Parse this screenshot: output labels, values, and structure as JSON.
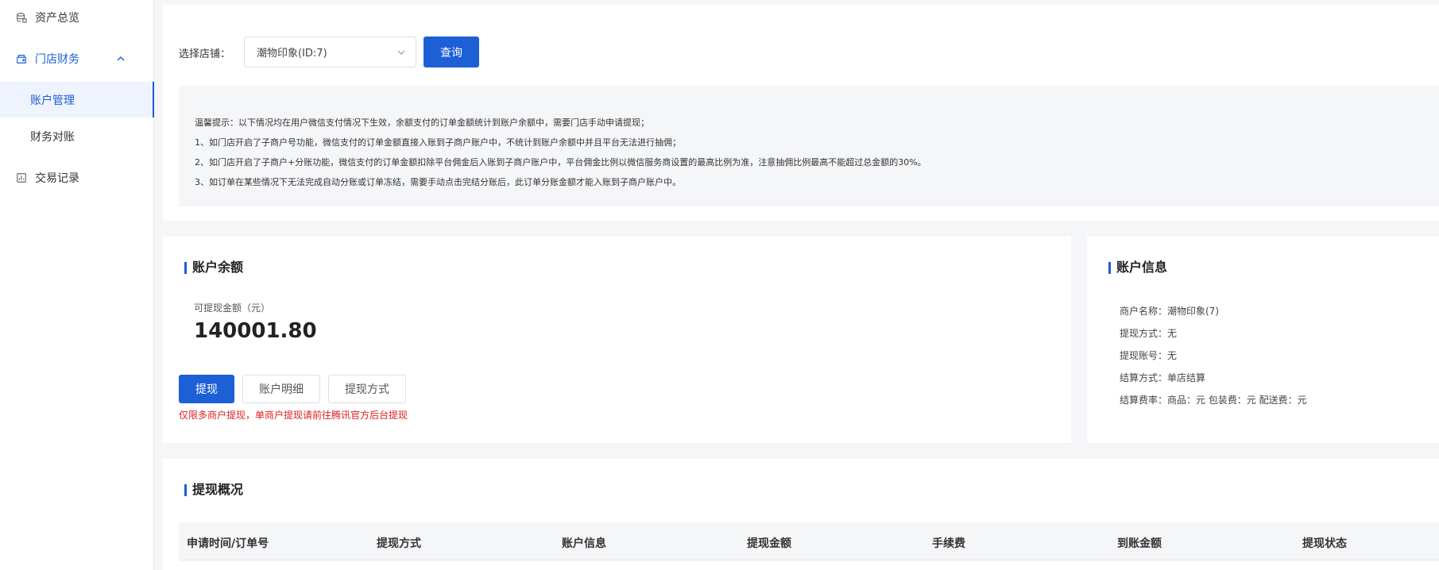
{
  "sidebar": {
    "items": [
      {
        "label": "资产总览",
        "icon": "wallet-icon"
      },
      {
        "label": "门店财务",
        "icon": "store-icon"
      },
      {
        "label": "账户管理"
      },
      {
        "label": "财务对账"
      },
      {
        "label": "交易记录",
        "icon": "chart-icon"
      }
    ]
  },
  "filter": {
    "store_label": "选择店铺：",
    "store_value": "潮物印象(ID:7)",
    "query_button": "查询"
  },
  "tips": {
    "lines": [
      "温馨提示：以下情况均在用户微信支付情况下生效，余额支付的订单金额统计到账户余额中，需要门店手动申请提现；",
      "1、如门店开启了子商户号功能，微信支付的订单金额直接入账到子商户账户中，不统计到账户余额中并且平台无法进行抽佣；",
      "2、如门店开启了子商户+分账功能，微信支付的订单金额扣除平台佣金后入账到子商户账户中，平台佣金比例以微信服务商设置的最高比例为准，注意抽佣比例最高不能超过总金额的30%。",
      "3、如订单在某些情况下无法完成自动分账或订单冻结，需要手动点击完结分账后，此订单分账金额才能入账到子商户账户中。"
    ]
  },
  "balance": {
    "title": "账户余额",
    "available_label": "可提现金额（元）",
    "amount": "140001.80",
    "withdraw_button": "提现",
    "detail_button": "账户明细",
    "method_button": "提现方式",
    "warning": "仅限多商户提现，单商户提现请前往腾讯官方后台提现",
    "warning_color": "#e02020"
  },
  "account_info": {
    "title": "账户信息",
    "rows": [
      "商户名称：潮物印象(7)",
      "提现方式：无",
      "提现账号：无",
      "结算方式：单店结算",
      "结算费率：商品：元 包装费：元 配送费：元"
    ]
  },
  "overview": {
    "title": "提现概况",
    "columns": [
      "申请时间/订单号",
      "提现方式",
      "账户信息",
      "提现金额",
      "手续费",
      "到账金额",
      "提现状态"
    ]
  },
  "colors": {
    "accent": "#1d5fd4",
    "background": "#f5f6f8"
  }
}
